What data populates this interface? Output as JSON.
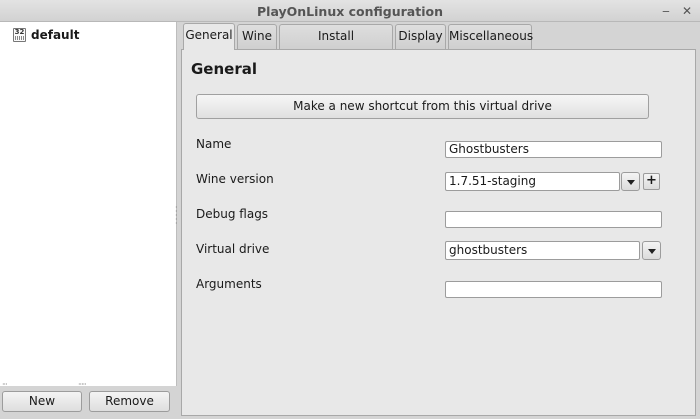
{
  "window": {
    "title": "PlayOnLinux configuration",
    "minimize_glyph": "‒",
    "close_glyph": "✕"
  },
  "sidebar": {
    "items": [
      {
        "label": "default",
        "icon": "wine-prefix-icon",
        "icon_text": "32"
      }
    ],
    "new_button": "New",
    "remove_button": "Remove"
  },
  "tabs": [
    {
      "label": "General",
      "active": true
    },
    {
      "label": "Wine",
      "active": false
    },
    {
      "label": "Install components",
      "active": false
    },
    {
      "label": "Display",
      "active": false
    },
    {
      "label": "Miscellaneous",
      "active": false
    }
  ],
  "general": {
    "heading": "General",
    "shortcut_button": "Make a new shortcut from this virtual drive",
    "fields": {
      "name": {
        "label": "Name",
        "value": "Ghostbusters"
      },
      "wine_version": {
        "label": "Wine version",
        "value": "1.7.51-staging",
        "add_glyph": "+"
      },
      "debug_flags": {
        "label": "Debug flags",
        "value": ""
      },
      "virtual_drive": {
        "label": "Virtual drive",
        "value": "ghostbusters"
      },
      "arguments": {
        "label": "Arguments",
        "value": ""
      }
    }
  },
  "colors": {
    "panel_bg": "#e8e8e8",
    "window_bg": "#d4d4d4",
    "sidebar_bg": "#ffffff"
  }
}
